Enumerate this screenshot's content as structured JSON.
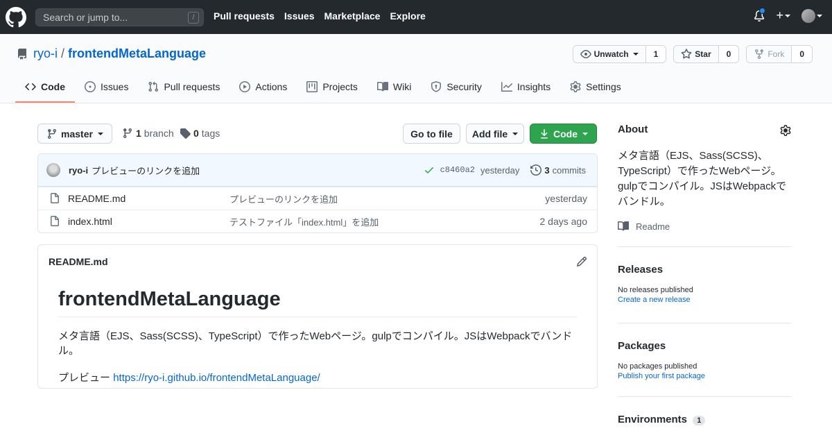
{
  "header": {
    "search_placeholder": "Search or jump to...",
    "slash_key": "/",
    "nav": [
      "Pull requests",
      "Issues",
      "Marketplace",
      "Explore"
    ],
    "plus": "+"
  },
  "repo": {
    "owner": "ryo-i",
    "separator": "/",
    "name": "frontendMetaLanguage",
    "watch_label": "Unwatch",
    "watch_count": "1",
    "star_label": "Star",
    "star_count": "0",
    "fork_label": "Fork",
    "fork_count": "0"
  },
  "tabs": [
    "Code",
    "Issues",
    "Pull requests",
    "Actions",
    "Projects",
    "Wiki",
    "Security",
    "Insights",
    "Settings"
  ],
  "toolbar": {
    "branch": "master",
    "branch_count": "1",
    "branch_word": "branch",
    "tag_count": "0",
    "tag_word": "tags",
    "go_to_file": "Go to file",
    "add_file": "Add file",
    "code": "Code"
  },
  "latest_commit": {
    "author": "ryo-i",
    "message": "プレビューのリンクを追加",
    "sha": "c8460a2",
    "time": "yesterday",
    "commit_count": "3",
    "commit_word": "commits"
  },
  "files": [
    {
      "name": "README.md",
      "message": "プレビューのリンクを追加",
      "age": "yesterday"
    },
    {
      "name": "index.html",
      "message": "テストファイル「index.html」を追加",
      "age": "2 days ago"
    }
  ],
  "readme": {
    "filename": "README.md",
    "title": "frontendMetaLanguage",
    "description": "メタ言語（EJS、Sass(SCSS)、TypeScript）で作ったWebページ。gulpでコンパイル。JSはWebpackでバンドル。",
    "preview_label": "プレビュー",
    "preview_url": "https://ryo-i.github.io/frontendMetaLanguage/"
  },
  "sidebar": {
    "about_title": "About",
    "about_desc": "メタ言語（EJS、Sass(SCSS)、TypeScript）で作ったWebページ。gulpでコンパイル。JSはWebpackでバンドル。",
    "readme_link": "Readme",
    "releases_title": "Releases",
    "releases_none": "No releases published",
    "releases_link": "Create a new release",
    "packages_title": "Packages",
    "packages_none": "No packages published",
    "packages_link": "Publish your first package",
    "environments_title": "Environments",
    "environments_count": "1"
  },
  "colors": {
    "header_bg": "#24292e",
    "link": "#0366d6",
    "green_button": "#2ea44f",
    "selected_tab_border": "#f9826c",
    "notification_dot": "#2188ff"
  }
}
